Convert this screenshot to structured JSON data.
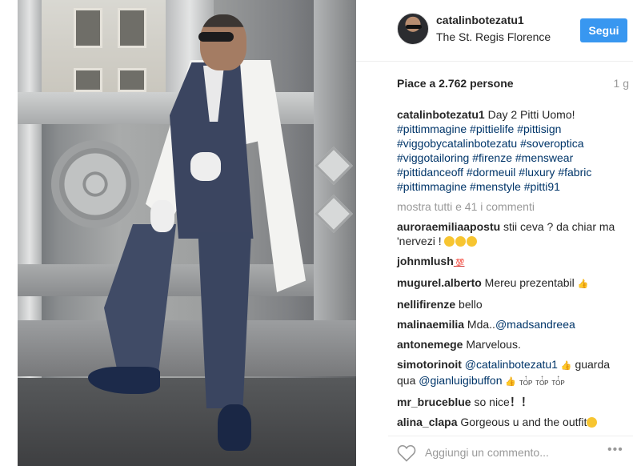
{
  "post": {
    "username": "catalinbotezatu1",
    "location": "The St. Regis Florence",
    "follow_label": "Segui",
    "likes": "Piace a 2.762 persone",
    "time": "1 g",
    "caption": {
      "user": "catalinbotezatu1",
      "text": " Day 2 Pitti Uomo! ",
      "tags": [
        "#pittimmagine",
        "#pittielife",
        "#pittisign",
        "#viggobycatalinbotezatu",
        "#soveroptica",
        "#viggotailoring",
        "#firenze",
        "#menswear",
        "#pittidanceoff",
        "#dormeuil",
        "#luxury",
        "#fabric",
        "#pittimmagine",
        "#menstyle",
        "#pitti91"
      ]
    },
    "load_more": "mostra tutti e 41 i commenti",
    "comments": [
      {
        "user": "auroraemiliaapostu",
        "text": " stii ceva ? da chiar ma 'nervezi ! "
      },
      {
        "user": "johnmlush",
        "text": " 💯"
      },
      {
        "user": "mugurel.alberto",
        "text": " Mereu prezentabil "
      },
      {
        "user": "nellifirenze",
        "text": " bello"
      },
      {
        "user": "malinaemilia",
        "text": " Mda..",
        "mention": "@madsandreea"
      },
      {
        "user": "antonemege",
        "text": " Marvelous."
      },
      {
        "user": "simotorinoit",
        "mention1": "@catalinbotezatu1",
        "text1": " guarda qua ",
        "mention2": "@gianluigibuffon"
      },
      {
        "user": "mr_bruceblue",
        "text": " so nice",
        "tail": "！！"
      },
      {
        "user": "alina_clapa",
        "text": " Gorgeous u and the outfit"
      }
    ],
    "comment_placeholder": "Aggiungi un commento...",
    "more_label": "•••",
    "top_label": "TOP"
  },
  "colors": {
    "accent": "#3897f0",
    "tag": "#003569",
    "muted": "#999999"
  },
  "icons": {
    "heart": "heart-outline-icon",
    "more": "more-options-icon"
  }
}
